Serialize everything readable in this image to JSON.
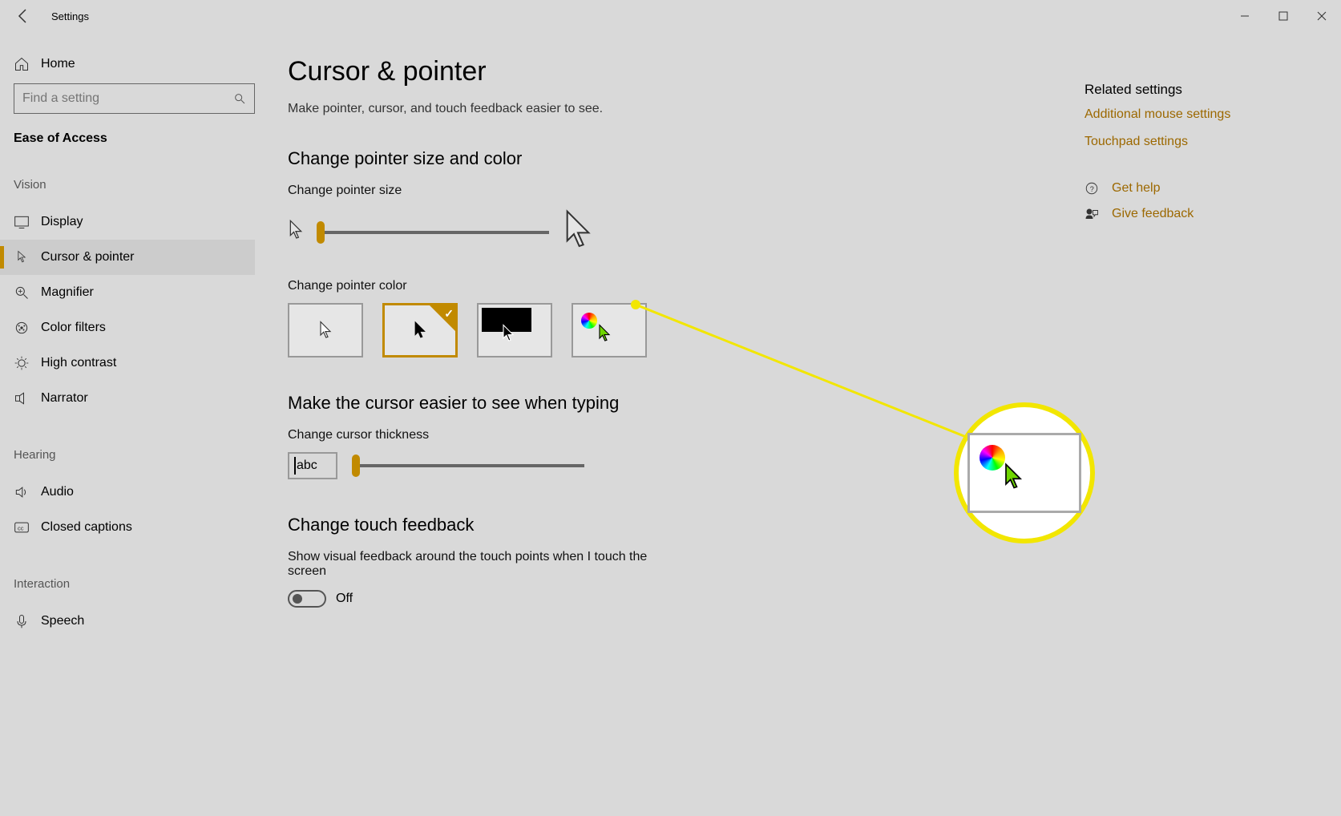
{
  "window": {
    "title": "Settings"
  },
  "sidebar": {
    "home": "Home",
    "search_placeholder": "Find a setting",
    "category": "Ease of Access",
    "sections": {
      "vision": "Vision",
      "hearing": "Hearing",
      "interaction": "Interaction"
    },
    "items": {
      "display": "Display",
      "cursor_pointer": "Cursor & pointer",
      "magnifier": "Magnifier",
      "color_filters": "Color filters",
      "high_contrast": "High contrast",
      "narrator": "Narrator",
      "audio": "Audio",
      "closed_captions": "Closed captions",
      "speech": "Speech"
    }
  },
  "main": {
    "title": "Cursor & pointer",
    "subtitle": "Make pointer, cursor, and touch feedback easier to see.",
    "section1": {
      "header": "Change pointer size and color",
      "size_label": "Change pointer size",
      "color_label": "Change pointer color"
    },
    "section2": {
      "header": "Make the cursor easier to see when typing",
      "label": "Change cursor thickness",
      "preview_text": "abc"
    },
    "section3": {
      "header": "Change touch feedback",
      "description": "Show visual feedback around the touch points when I touch the screen",
      "toggle_state": "Off"
    }
  },
  "related": {
    "header": "Related settings",
    "link1": "Additional mouse settings",
    "link2": "Touchpad settings",
    "help": "Get help",
    "feedback": "Give feedback"
  },
  "colors": {
    "accent": "#c18a00",
    "link": "#9c6800"
  }
}
